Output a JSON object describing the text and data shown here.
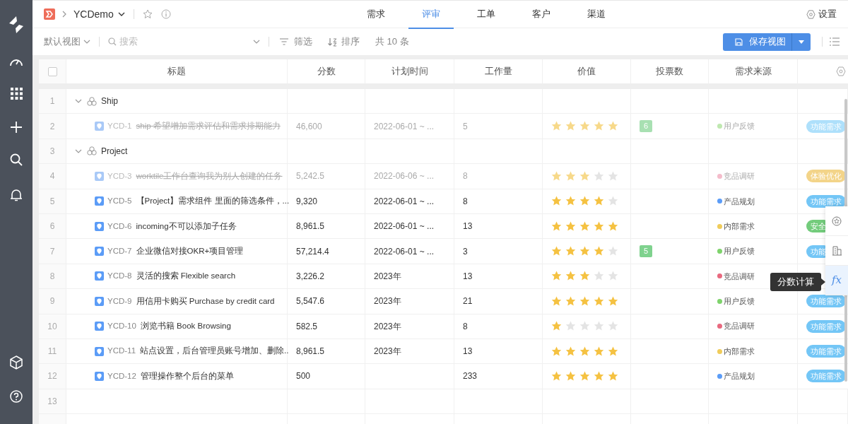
{
  "project": {
    "name": "YCDemo"
  },
  "tabs": [
    {
      "label": "需求",
      "selected": false
    },
    {
      "label": "评审",
      "selected": true
    },
    {
      "label": "工单",
      "selected": false
    },
    {
      "label": "客户",
      "selected": false
    },
    {
      "label": "渠道",
      "selected": false
    }
  ],
  "settings_label": "设置",
  "toolbar": {
    "view": "默认视图",
    "search_placeholder": "搜索",
    "filter": "筛选",
    "sort": "排序",
    "count": "共 10 条",
    "save_button": "保存视图"
  },
  "table": {
    "select_all": {
      "checked": false
    },
    "columns": [
      "标题",
      "分数",
      "计划时间",
      "工作量",
      "价值",
      "投票数",
      "需求来源"
    ],
    "rows": [
      {
        "kind": "group",
        "number": "1",
        "title": "Ship",
        "expanded": true
      },
      {
        "kind": "item",
        "number": "2",
        "id": "YCD-1",
        "title": "ship 希望增加需求评估和需求排期能力",
        "done": true,
        "score": "46,600",
        "plan": "2022-06-01 ~ ...",
        "workload": "5",
        "stars": 5,
        "votes": "6",
        "source": {
          "text": "用户反馈",
          "color": "#bfe8b0"
        },
        "tag": {
          "text": "功能需求",
          "color": "#aee0fb"
        }
      },
      {
        "kind": "group",
        "number": "3",
        "title": "Project",
        "expanded": true
      },
      {
        "kind": "item",
        "number": "4",
        "id": "YCD-3",
        "title": "worktile工作台查询我为别人创建的任务",
        "done": true,
        "score": "5,242.5",
        "plan": "2022-06-06 ~ ...",
        "workload": "8",
        "stars": 3,
        "source": {
          "text": "竞品调研",
          "color": "#f4bccb"
        },
        "tag": {
          "text": "体验优化",
          "color": "#f3d489"
        }
      },
      {
        "kind": "item",
        "number": "5",
        "id": "YCD-5",
        "title": "【Project】需求组件 里面的筛选条件，...",
        "done": false,
        "score": "9,320",
        "plan": "2022-06-01 ~ ...",
        "workload": "8",
        "stars": 4,
        "source": {
          "text": "产品规划",
          "color": "#5b9cf7"
        },
        "tag": {
          "text": "功能需求",
          "color": "#73c6f6"
        }
      },
      {
        "kind": "item",
        "number": "6",
        "id": "YCD-6",
        "title": "incoming不可以添加子任务",
        "done": false,
        "score": "8,961.5",
        "plan": "2022-06-01 ~ ...",
        "workload": "13",
        "stars": 5,
        "source": {
          "text": "内部需求",
          "color": "#f0cc5a"
        },
        "tag": {
          "text": "安全",
          "color": "#73cc7c"
        }
      },
      {
        "kind": "item",
        "number": "7",
        "id": "YCD-7",
        "title": "企业微信对接OKR+项目管理",
        "done": false,
        "score": "57,214.4",
        "plan": "2022-06-01 ~ ...",
        "workload": "3",
        "stars": 4,
        "votes": "5",
        "source": {
          "text": "用户反馈",
          "color": "#7ed36b"
        },
        "tag": {
          "text": "功能",
          "color": "#73c6f6"
        }
      },
      {
        "kind": "item",
        "number": "8",
        "id": "YCD-8",
        "title": "灵活的搜索 Flexible search",
        "done": false,
        "score": "3,226.2",
        "plan": "2023年",
        "workload": "13",
        "stars": 3,
        "source": {
          "text": "竞品调研",
          "color": "#e8697f"
        }
      },
      {
        "kind": "item",
        "number": "9",
        "id": "YCD-9",
        "title": "用信用卡购买 Purchase by credit card",
        "done": false,
        "score": "5,547.6",
        "plan": "2023年",
        "workload": "21",
        "stars": 5,
        "source": {
          "text": "用户反馈",
          "color": "#7ed36b"
        },
        "tag": {
          "text": "功能需求",
          "color": "#73c6f6"
        }
      },
      {
        "kind": "item",
        "number": "10",
        "id": "YCD-10",
        "title": "浏览书籍 Book Browsing",
        "done": false,
        "score": "582.5",
        "plan": "2023年",
        "workload": "8",
        "stars": 1,
        "source": {
          "text": "竞品调研",
          "color": "#e8697f"
        },
        "tag": {
          "text": "功能需求",
          "color": "#73c6f6"
        }
      },
      {
        "kind": "item",
        "number": "11",
        "id": "YCD-11",
        "title": "站点设置，后台管理员账号增加、删除..",
        "done": false,
        "score": "8,961.5",
        "plan": "2023年",
        "workload": "13",
        "stars": 5,
        "source": {
          "text": "内部需求",
          "color": "#f0cc5a"
        },
        "tag": {
          "text": "功能需求",
          "color": "#73c6f6"
        }
      },
      {
        "kind": "item",
        "number": "12",
        "id": "YCD-12",
        "title": "管理操作整个后台的菜单",
        "done": false,
        "score": "500",
        "workload": "233",
        "stars": 5,
        "source": {
          "text": "产品规划",
          "color": "#5b9cf7"
        },
        "tag": {
          "text": "功能需求",
          "color": "#73c6f6"
        }
      },
      {
        "kind": "empty",
        "number": "13"
      }
    ]
  },
  "side_tools": [
    {
      "kind": "star",
      "selected": false
    },
    {
      "kind": "report",
      "selected": false
    },
    {
      "kind": "formula",
      "label": "fx",
      "selected": true
    }
  ],
  "tooltip": "分数计算"
}
